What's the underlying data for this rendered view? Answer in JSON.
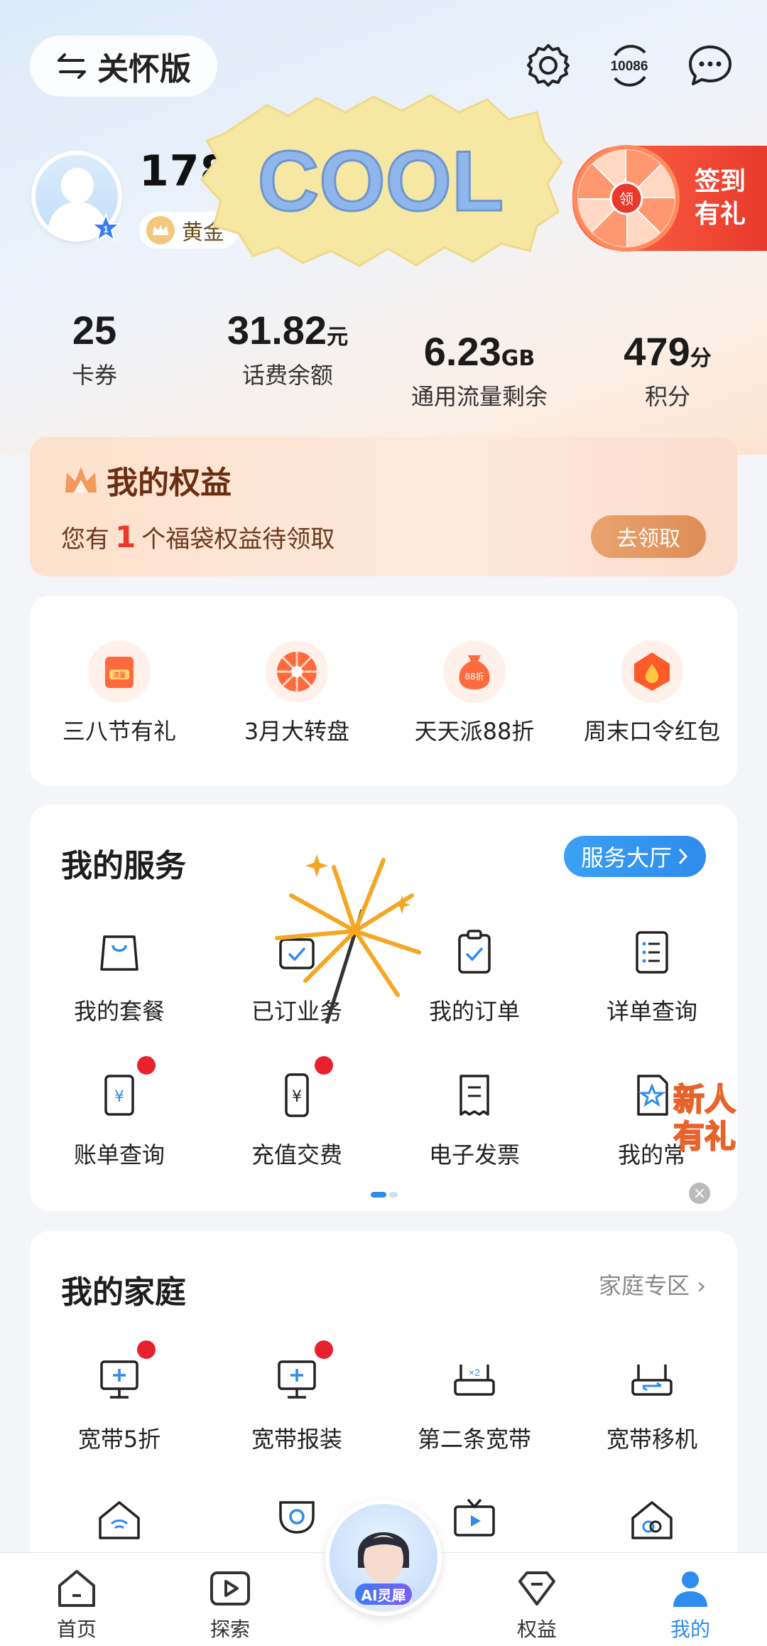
{
  "header": {
    "care_mode_label": "关怀版",
    "hotline_label": "10086",
    "icons": [
      "swap-arrows-icon",
      "gear-icon",
      "hotline-10086-icon",
      "chat-bubble-icon"
    ]
  },
  "profile": {
    "phone_partial": "178*",
    "level_partial": "黄金",
    "avatar_badge_level": "1"
  },
  "sticker": {
    "text": "COOL"
  },
  "signin": {
    "line1": "签到",
    "line2": "有礼",
    "wheel_center": "领"
  },
  "stats": [
    {
      "value": "25",
      "unit": "",
      "label": "卡券"
    },
    {
      "value": "31.82",
      "unit": "元",
      "label": "话费余额"
    },
    {
      "value": "6.23",
      "unit": "GB",
      "label": "通用流量剩余"
    },
    {
      "value": "479",
      "unit": "分",
      "label": "积分"
    }
  ],
  "benefits": {
    "title": "我的权益",
    "sub_prefix": "您有",
    "count": "1",
    "sub_suffix": "个福袋权益待领取",
    "button": "去领取"
  },
  "promos": [
    {
      "label": "三八节有礼",
      "icon": "gift-ticket-icon",
      "badge": "流量"
    },
    {
      "label": "3月大转盘",
      "icon": "wheel-icon"
    },
    {
      "label": "天天派88折",
      "icon": "money-bag-icon",
      "badge": "88折"
    },
    {
      "label": "周末口令红包",
      "icon": "red-packet-icon"
    }
  ],
  "services": {
    "title": "我的服务",
    "hall_button": "服务大厅",
    "items": [
      {
        "label": "我的套餐",
        "icon": "bag-icon"
      },
      {
        "label": "已订业务",
        "icon": "subscribed-icon"
      },
      {
        "label": "我的订单",
        "icon": "clipboard-check-icon"
      },
      {
        "label": "详单查询",
        "icon": "list-doc-icon"
      },
      {
        "label": "账单查询",
        "icon": "bill-yen-icon"
      },
      {
        "label": "充值交费",
        "icon": "phone-yen-icon"
      },
      {
        "label": "电子发票",
        "icon": "invoice-icon"
      },
      {
        "label": "我的常",
        "icon": "star-doc-icon"
      }
    ]
  },
  "newbie": {
    "line1": "新人",
    "line2": "有礼"
  },
  "family": {
    "title": "我的家庭",
    "zone_link": "家庭专区",
    "items": [
      {
        "label": "宽带5折",
        "icon": "monitor-plus-icon"
      },
      {
        "label": "宽带报装",
        "icon": "monitor-plus-icon"
      },
      {
        "label": "第二条宽带",
        "icon": "router-x2-icon"
      },
      {
        "label": "宽带移机",
        "icon": "router-move-icon"
      }
    ],
    "row2_icons": [
      "home-wifi-icon",
      "camera-icon",
      "tv-play-icon",
      "home-link-icon"
    ]
  },
  "bottom_nav": [
    {
      "label": "首页",
      "icon": "home-icon"
    },
    {
      "label": "探索",
      "icon": "play-box-icon"
    },
    {
      "label": "AI灵犀",
      "icon": "ai-assistant-avatar"
    },
    {
      "label": "权益",
      "icon": "diamond-icon"
    },
    {
      "label": "我的",
      "icon": "person-icon",
      "active": true
    }
  ],
  "colors": {
    "accent": "#2f8bec",
    "red": "#e8212e",
    "orange": "#e8392b"
  }
}
